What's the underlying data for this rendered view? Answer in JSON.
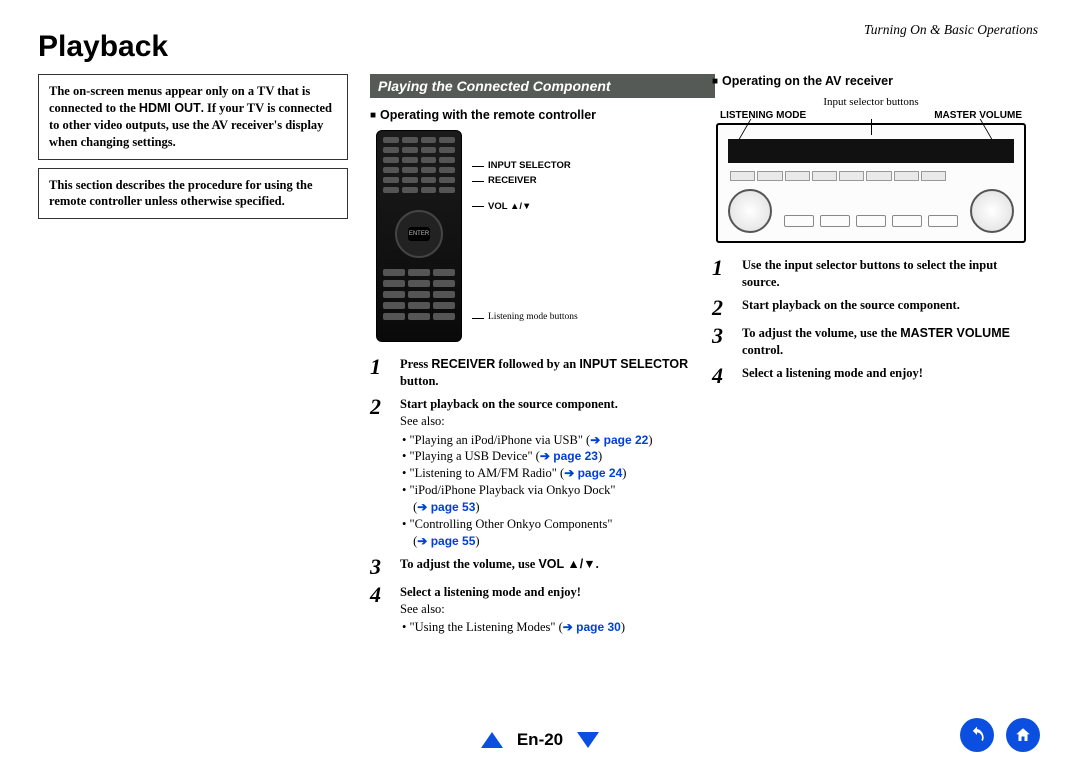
{
  "breadcrumb": "Turning On & Basic Operations",
  "page_title": "Playback",
  "note1_parts": {
    "a": "The on-screen menus appear only on a TV that is connected to the ",
    "hdmi": "HDMI OUT",
    "b": ". If your TV is connected to other video outputs, use the AV receiver's display when changing settings."
  },
  "note2": "This section describes the procedure for using the remote controller unless otherwise specified.",
  "section_banner": "Playing the Connected Component",
  "mid": {
    "subhead": "Operating with the remote controller",
    "remote_labels": {
      "l1": "INPUT SELECTOR",
      "l2": "RECEIVER",
      "l3": "VOL ▲/▼",
      "l4": "Listening mode buttons"
    },
    "enter": "ENTER",
    "steps": [
      {
        "lead_parts": {
          "a": "Press ",
          "b": "RECEIVER",
          "c": " followed by an ",
          "d": "INPUT SELECTOR",
          "e": " button."
        }
      },
      {
        "lead": "Start playback on the source component.",
        "seealso": "See also:",
        "items": [
          {
            "text": "\"Playing an iPod/iPhone via USB\" (",
            "page": "page 22",
            "tail": ")"
          },
          {
            "text": "\"Playing a USB Device\" (",
            "page": "page 23",
            "tail": ")"
          },
          {
            "text": "\"Listening to AM/FM Radio\" (",
            "page": "page 24",
            "tail": ")"
          },
          {
            "text": "\"iPod/iPhone Playback via Onkyo Dock\"",
            "break": true,
            "page": "page 53",
            "tail": ")"
          },
          {
            "text": "\"Controlling Other Onkyo Components\"",
            "break": true,
            "page": "page 55",
            "tail": ")"
          }
        ]
      },
      {
        "lead_parts": {
          "a": "To adjust the volume, use ",
          "b": "VOL ▲/▼",
          "c": "."
        }
      },
      {
        "lead": "Select a listening mode and enjoy!",
        "seealso": "See also:",
        "items": [
          {
            "text": "\"Using the Listening Modes\" (",
            "page": "page 30",
            "tail": ")"
          }
        ]
      }
    ]
  },
  "right": {
    "subhead": "Operating on the AV receiver",
    "caption": "Input selector buttons",
    "label_left": "LISTENING MODE",
    "label_right": "MASTER VOLUME",
    "steps": [
      {
        "lead": "Use the input selector buttons to select the input source."
      },
      {
        "lead": "Start playback on the source component."
      },
      {
        "lead_parts": {
          "a": "To adjust the volume, use the ",
          "b": "MASTER VOLUME",
          "c": " control."
        }
      },
      {
        "lead": "Select a listening mode and enjoy!"
      }
    ]
  },
  "footer": {
    "page": "En-20"
  }
}
